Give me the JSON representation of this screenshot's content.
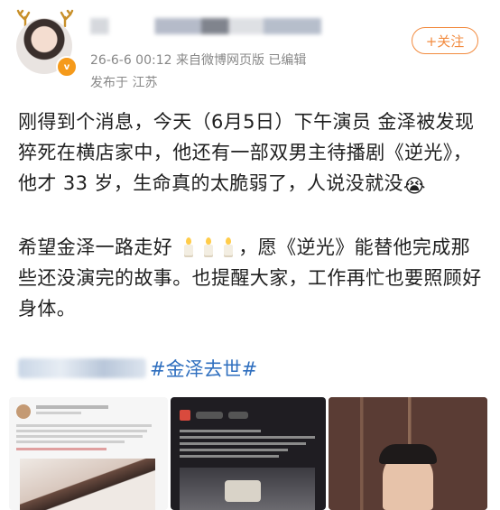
{
  "post": {
    "meta": "26-6-6 00:12  来自微博网页版  已编辑",
    "location": "发布于 江苏",
    "follow_label": "+关注",
    "vip_badge": "v"
  },
  "content": {
    "para1": "刚得到个消息，今天（6月5日）下午演员 金泽被发现猝死在横店家中，他还有一部双男主待播剧《逆光》，他才 33 岁，生命真的太脆弱了，人说没就没",
    "para1_emoji": "😭",
    "para2_a": "希望金泽一路走好",
    "para2_b": "，愿《逆光》能替他完成那些还没演完的故事。也提醒大家，工作再忙也要照顾好身体。",
    "topic": "#金泽去世#"
  },
  "images": [
    {
      "icon": "screenshot-image"
    },
    {
      "icon": "screenshot-image"
    },
    {
      "icon": "portrait-photo"
    }
  ],
  "colors": {
    "accent": "#f28b3f",
    "link": "#2f6fbf",
    "vip": "#f59a1b",
    "meta": "#888888"
  }
}
